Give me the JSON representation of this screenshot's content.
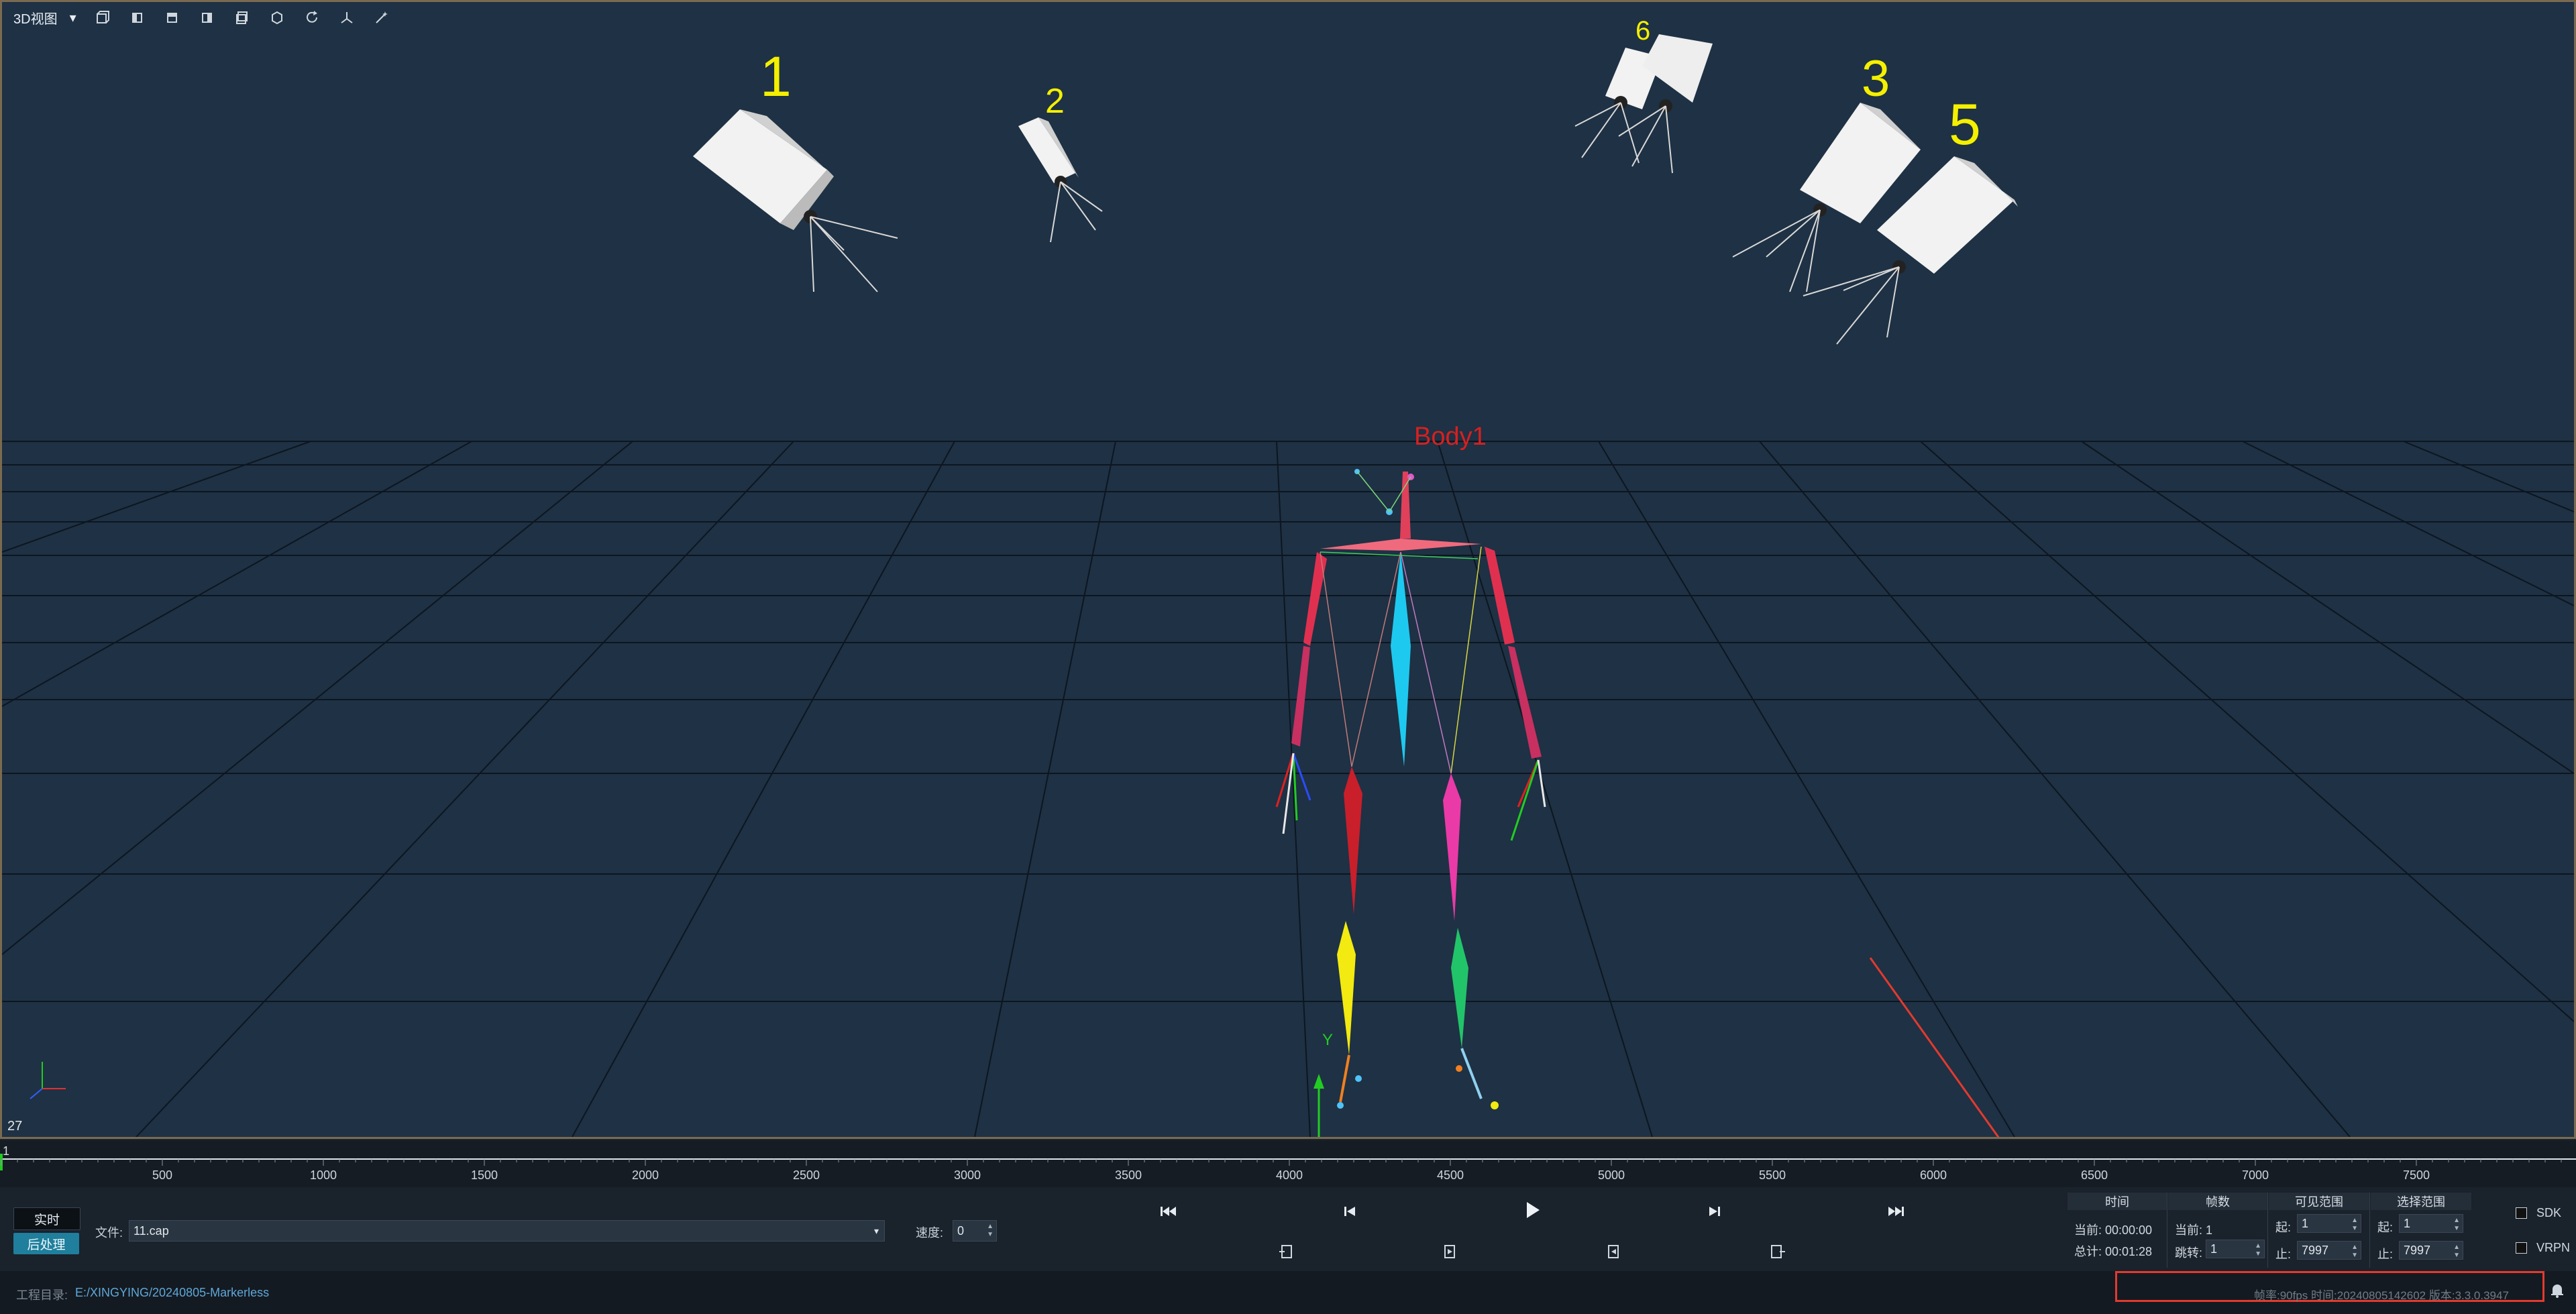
{
  "toolbar": {
    "view_mode": "3D视图",
    "tools": [
      "cube-front-icon",
      "cube-left-icon",
      "cube-top-icon",
      "cube-right-icon",
      "cube-back-icon",
      "cube-iso-icon",
      "refresh-icon",
      "axis-icon",
      "magic-wand-icon"
    ]
  },
  "scene": {
    "cameras": [
      "1",
      "2",
      "3",
      "5",
      "6"
    ],
    "body_label": "Body1",
    "axis_label": "Y",
    "corner_frame": "27"
  },
  "timeline": {
    "start": "1",
    "ticks": [
      "500",
      "1000",
      "1500",
      "2000",
      "2500",
      "3000",
      "3500",
      "4000",
      "4500",
      "5000",
      "5500",
      "6000",
      "6500",
      "7000",
      "7500"
    ],
    "min": 0,
    "max": 7997
  },
  "controls": {
    "realtime_label": "实时",
    "post_label": "后处理",
    "file_label": "文件:",
    "file_value": "11.cap",
    "speed_label": "速度:",
    "speed_value": "0"
  },
  "info": {
    "time_header": "时间",
    "time_current": "当前: 00:00:00",
    "time_total": "总计: 00:01:28",
    "frames_header": "帧数",
    "frames_current": "当前: 1",
    "jump_label": "跳转:",
    "jump_value": "1",
    "visible_header": "可见范围",
    "visible_start_label": "起:",
    "visible_start": "1",
    "visible_end_label": "止:",
    "visible_end": "7997",
    "select_header": "选择范围",
    "select_start_label": "起:",
    "select_start": "1",
    "select_end_label": "止:",
    "select_end": "7997",
    "sdk_label": "SDK",
    "vrpn_label": "VRPN"
  },
  "status": {
    "project_label": "工程目录:",
    "project_path": "E:/XINGYING/20240805-Markerless",
    "info": "帧率:90fps  时间:20240805142602  版本:3.3.0.3947"
  },
  "colors": {
    "highlight": "#e33a2e",
    "accent": "#1f7f9c"
  }
}
